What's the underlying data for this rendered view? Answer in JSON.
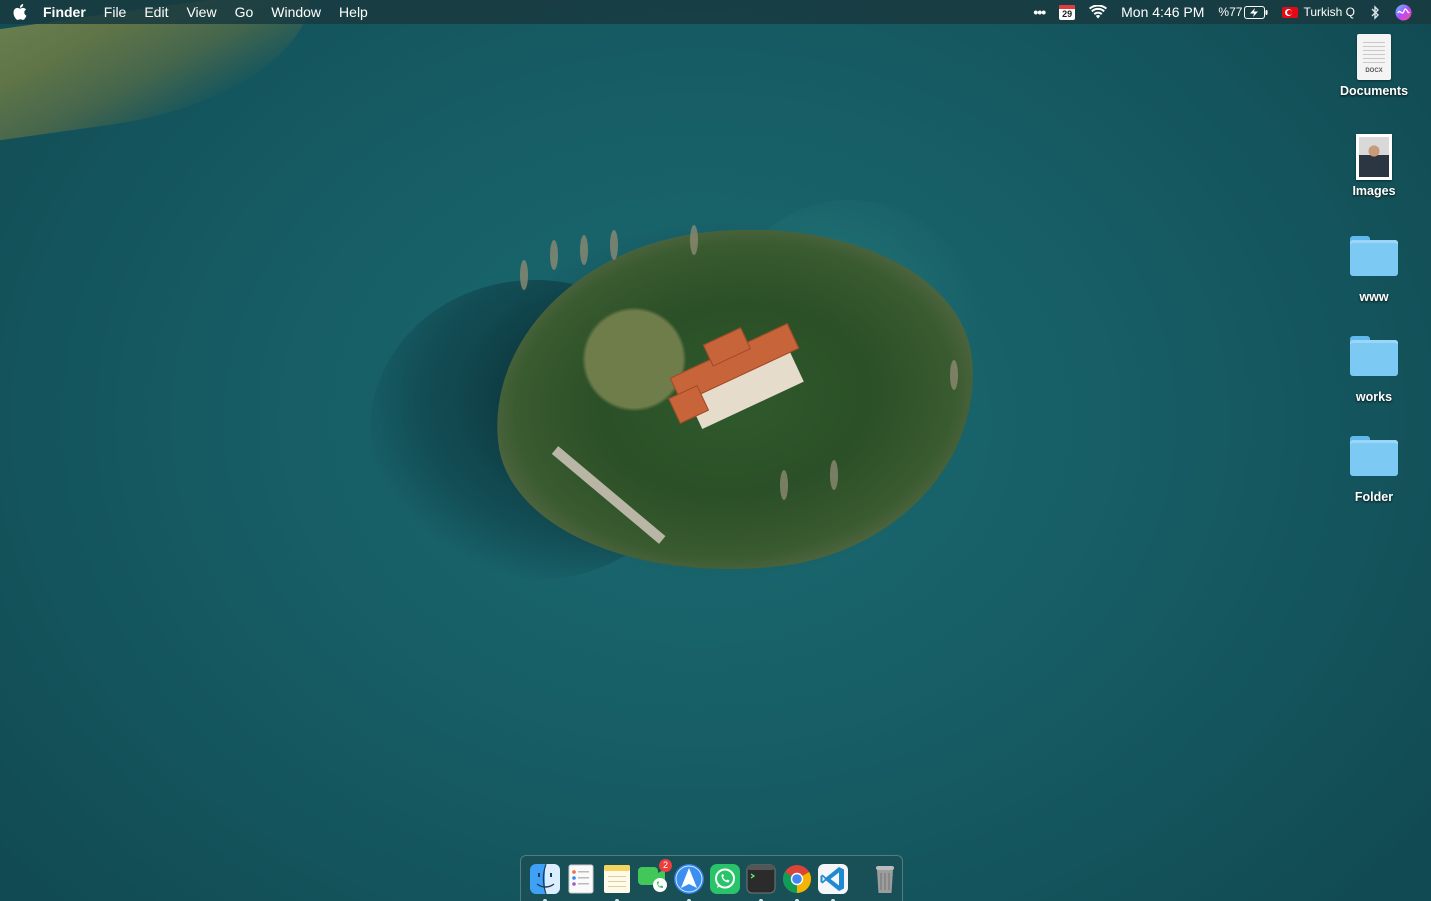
{
  "menubar": {
    "app_name": "Finder",
    "menus": [
      "File",
      "Edit",
      "View",
      "Go",
      "Window",
      "Help"
    ],
    "status": {
      "more": "•••",
      "calendar_day": "29",
      "clock": "Mon 4:46 PM",
      "battery": "%77",
      "input_source": "Turkish Q"
    }
  },
  "desktop_icons": [
    {
      "label": "Documents",
      "icon": "docx-file-icon"
    },
    {
      "label": "Images",
      "icon": "image-file-icon"
    },
    {
      "label": "www",
      "icon": "folder-icon"
    },
    {
      "label": "works",
      "icon": "folder-icon"
    },
    {
      "label": "Folder",
      "icon": "folder-icon"
    }
  ],
  "documents_tag": "DOCX",
  "dock": {
    "apps": [
      {
        "name": "finder",
        "running": true
      },
      {
        "name": "reminders",
        "running": false
      },
      {
        "name": "notes",
        "running": true
      },
      {
        "name": "facetime",
        "running": false,
        "badge": "2"
      },
      {
        "name": "send-app",
        "running": true
      },
      {
        "name": "whatsapp",
        "running": false
      },
      {
        "name": "terminal",
        "running": true
      },
      {
        "name": "chrome",
        "running": true
      },
      {
        "name": "vscode",
        "running": true
      }
    ],
    "trash": "trash"
  },
  "colors": {
    "water": "#175e66",
    "menubar": "#183a40",
    "folder": "#7ccaf4"
  }
}
